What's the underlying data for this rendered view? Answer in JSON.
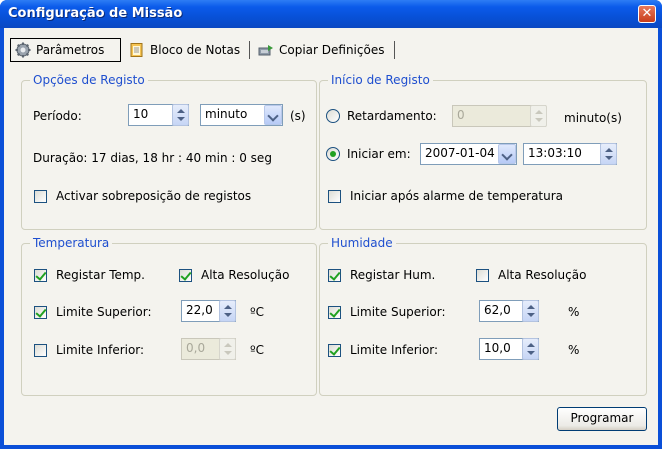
{
  "window": {
    "title": "Configuração de Missão",
    "close_glyph": "✕"
  },
  "tabs": [
    {
      "label": "Parâmetros",
      "icon": "gear-icon",
      "active": true
    },
    {
      "label": "Bloco de Notas",
      "icon": "notepad-icon",
      "active": false
    },
    {
      "label": "Copiar Definições",
      "icon": "copy-settings-icon",
      "active": false
    }
  ],
  "registo": {
    "title": "Opções de Registo",
    "periodo_label": "Período:",
    "periodo_value": "10",
    "unit_value": "minuto",
    "unit_suffix": "(s)",
    "duracao": "Duração: 17 dias, 18 hr : 40 min : 0 seg",
    "sobreposicao_label": "Activar sobreposição de registos",
    "sobreposicao_checked": false
  },
  "inicio": {
    "title": "Início de Registo",
    "retardamento_label": "Retardamento:",
    "retardamento_value": "0",
    "retardamento_unit": "minuto(s)",
    "iniciar_label": "Iniciar em:",
    "date_value": "2007-01-04",
    "time_value": "13:03:10",
    "alarme_label": "Iniciar após alarme de temperatura",
    "alarme_checked": false,
    "selected_option": "iniciar"
  },
  "temperatura": {
    "title": "Temperatura",
    "registar_label": "Registar Temp.",
    "registar_checked": true,
    "alta_label": "Alta Resolução",
    "alta_checked": true,
    "superior_label": "Limite Superior:",
    "superior_checked": true,
    "superior_value": "22,0",
    "superior_unit": "ºC",
    "inferior_label": "Limite Inferior:",
    "inferior_checked": false,
    "inferior_value": "0,0",
    "inferior_unit": "ºC"
  },
  "humidade": {
    "title": "Humidade",
    "registar_label": "Registar Hum.",
    "registar_checked": true,
    "alta_label": "Alta Resolução",
    "alta_checked": false,
    "superior_label": "Limite Superior:",
    "superior_checked": true,
    "superior_value": "62,0",
    "superior_unit": "%",
    "inferior_label": "Limite Inferior:",
    "inferior_checked": true,
    "inferior_value": "10,0",
    "inferior_unit": "%"
  },
  "footer": {
    "programar_label": "Programar"
  }
}
